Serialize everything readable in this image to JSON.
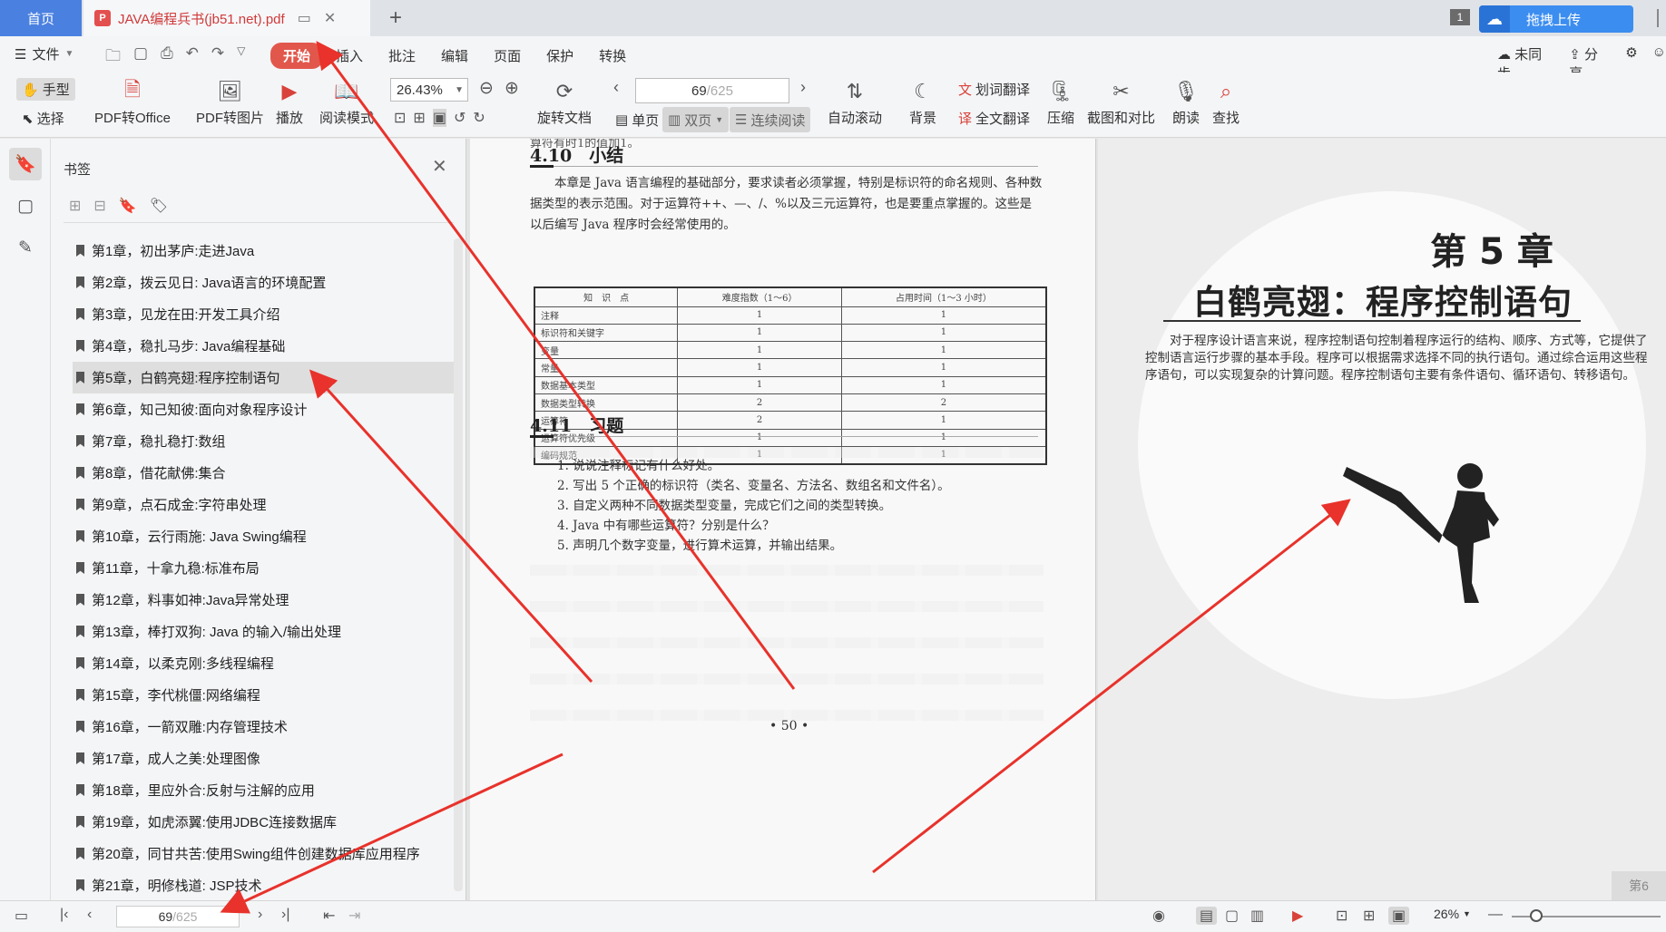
{
  "titlebar": {
    "home_tab": "首页",
    "doc_tab_title": "JAVA编程兵书(jb51.net).pdf",
    "pdf_badge": "P",
    "window_count": "1",
    "upload_label": "拖拽上传"
  },
  "menubar": {
    "file_label": "文件",
    "menus": [
      "开始",
      "插入",
      "批注",
      "编辑",
      "页面",
      "保护",
      "转换"
    ],
    "active_menu": "开始",
    "unsynced_label": "未同步",
    "share_label": "分享"
  },
  "toolbar": {
    "hand_label": "手型",
    "select_label": "选择",
    "pdf_to_office": "PDF转Office",
    "pdf_to_image": "PDF转图片",
    "play_label": "播放",
    "read_mode": "阅读模式",
    "zoom_value": "26.43%",
    "rotate_label": "旋转文档",
    "page_current": "69",
    "page_total": "/625",
    "single_page": "单页",
    "double_page": "双页",
    "continuous": "连续阅读",
    "auto_scroll": "自动滚动",
    "background": "背景",
    "word_translate": "划词翻译",
    "full_translate": "全文翻译",
    "compress": "压缩",
    "screenshot_compare": "截图和对比",
    "read_aloud": "朗读",
    "search": "查找"
  },
  "bookmarks": {
    "title": "书签",
    "selected_index": 4,
    "items": [
      "第1章，初出茅庐:走进Java",
      "第2章，拨云见日: Java语言的环境配置",
      "第3章，见龙在田:开发工具介绍",
      "第4章，稳扎马步: Java编程基础",
      "第5章，白鹤亮翅:程序控制语句",
      "第6章，知己知彼:面向对象程序设计",
      "第7章，稳扎稳打:数组",
      "第8章，借花献佛:集合",
      "第9章，点石成金:字符串处理",
      "第10章，云行雨施: Java Swing编程",
      "第11章，十拿九稳:标准布局",
      "第12章，料事如神:Java异常处理",
      "第13章，棒打双狗: Java 的输入/输出处理",
      "第14章，以柔克刚:多线程编程",
      "第15章，李代桃僵:网络编程",
      "第16章，一箭双雕:内存管理技术",
      "第17章，成人之美:处理图像",
      "第18章，里应外合:反射与注解的应用",
      "第19章，如虎添翼:使用JDBC连接数据库",
      "第20章，同甘共苦:使用Swing组件创建数据库应用程序",
      "第21章，明修栈道: JSP技术"
    ]
  },
  "left_page": {
    "top_cut_text": "算符有时1的值加1。",
    "section1_heading": "4.10　小结",
    "summary_text": "本章是 Java 语言编程的基础部分，要求读者必须掌握，特别是标识符的命名规则、各种数据类型的表示范围。对于运算符++、—、/、%以及三元运算符，也是要重点掌握的。这些是以后编写 Java 程序时会经常使用的。",
    "table_headers": [
      "知　识　点",
      "难度指数（1～6）",
      "占用时间（1～3 小时）"
    ],
    "table_rows": [
      [
        "注释",
        "1",
        "1"
      ],
      [
        "标识符和关键字",
        "1",
        "1"
      ],
      [
        "变量",
        "1",
        "1"
      ],
      [
        "常量",
        "1",
        "1"
      ],
      [
        "数据基本类型",
        "1",
        "1"
      ],
      [
        "数据类型转换",
        "2",
        "2"
      ],
      [
        "运算符",
        "2",
        "1"
      ],
      [
        "运算符优先级",
        "1",
        "1"
      ],
      [
        "编码规范",
        "1",
        "1"
      ]
    ],
    "section2_heading": "4.11　习题",
    "exercises": [
      "1.  说说注释标记有什么好处。",
      "2.  写出 5 个正确的标识符（类名、变量名、方法名、数组名和文件名）。",
      "3.  自定义两种不同数据类型变量，完成它们之间的类型转换。",
      "4.  Java 中有哪些运算符？分别是什么？",
      "5.  声明几个数字变量，进行算术运算，并输出结果。"
    ],
    "page_number": "• 50 •"
  },
  "right_page": {
    "chapter_label": "第 5 章",
    "chapter_title": "白鹤亮翅：程序控制语句",
    "intro_text": "对于程序设计语言来说，程序控制语句控制着程序运行的结构、顺序、方式等，它提供了控制语言运行步骤的基本手段。程序可以根据需求选择不同的执行语句。通过综合运用这些程序语句，可以实现复杂的计算问题。程序控制语句主要有条件语句、循环语句、转移语句。",
    "corner_text": "第6"
  },
  "statusbar": {
    "page_current": "69",
    "page_total": "/625",
    "zoom_value": "26%"
  },
  "colors": {
    "accent_red": "#e2574c",
    "home_tab_blue": "#4a80e0",
    "arrow_red": "#e8322b"
  }
}
